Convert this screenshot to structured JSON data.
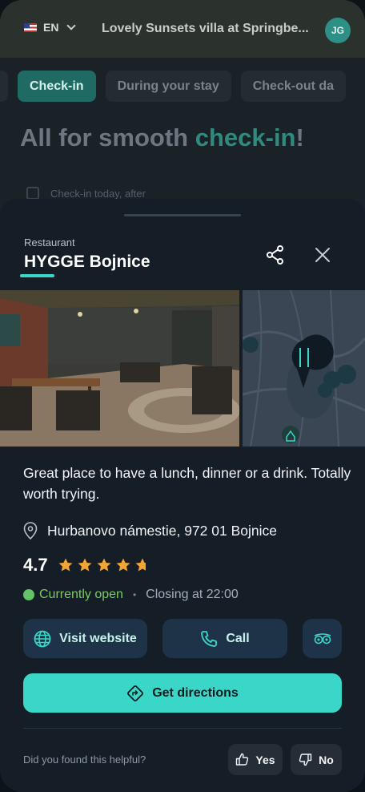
{
  "background": {
    "language": "EN",
    "property_title": "Lovely Sunsets villa at Springbe...",
    "avatar_initials": "JG",
    "tabs": [
      "Check-in",
      "During your stay",
      "Check-out da"
    ],
    "active_tab": "Check-in",
    "heading_prefix": "All for smooth ",
    "heading_accent": "check-in",
    "heading_suffix": "!",
    "checklist_item": "Check-in today, after"
  },
  "place": {
    "category": "Restaurant",
    "name": "HYGGE Bojnice",
    "description": "Great place to have a lunch, dinner or a drink. Totally worth trying.",
    "address": "Hurbanovo námestie, 972 01 Bojnice",
    "rating": "4.7",
    "rating_value": 4.7,
    "rating_max": 5,
    "open_status": "Currently open",
    "closing_text": "Closing at 22:00",
    "bullet": "•"
  },
  "actions": {
    "visit_website": "Visit website",
    "call": "Call",
    "get_directions": "Get directions"
  },
  "feedback": {
    "question": "Did you found this helpful?",
    "yes": "Yes",
    "no": "No"
  },
  "colors": {
    "accent": "#3ad7c9",
    "sheet_bg": "#151d27",
    "button_bg": "#1e3347",
    "star": "#f2a534",
    "open_green": "#62c465"
  },
  "icons": {
    "share": "share-icon",
    "close": "close-icon",
    "location": "location-pin-icon",
    "globe": "globe-icon",
    "phone": "phone-icon",
    "tripadvisor": "tripadvisor-icon",
    "directions": "directions-icon",
    "thumbs_up": "thumbs-up-icon",
    "thumbs_down": "thumbs-down-icon"
  }
}
